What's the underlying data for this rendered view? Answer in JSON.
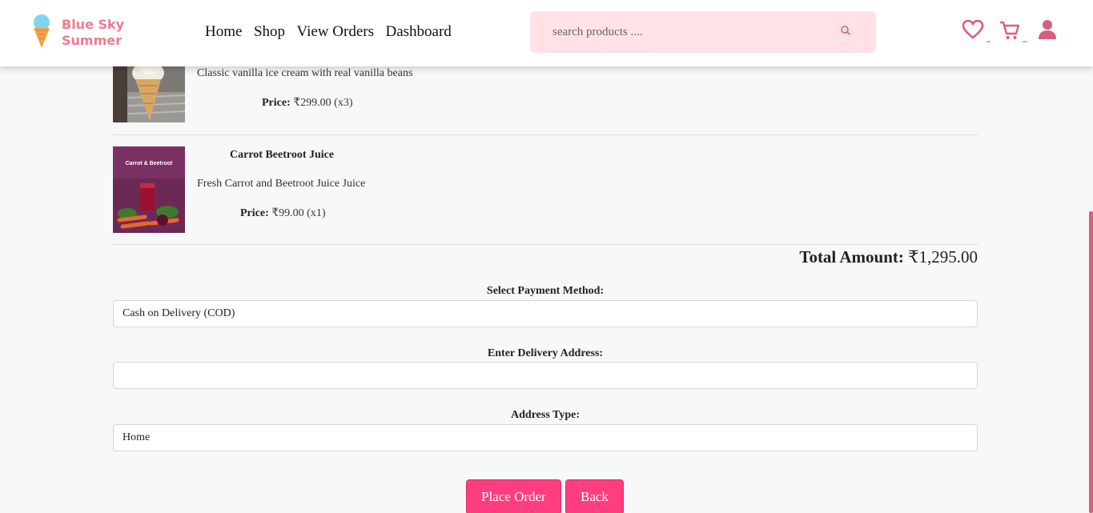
{
  "brand": {
    "line1": "Blue Sky",
    "line2": "Summer"
  },
  "nav": {
    "home": "Home",
    "shop": "Shop",
    "orders": "View Orders",
    "dashboard": "Dashboard"
  },
  "search": {
    "placeholder": "search products ....",
    "icon": "search-icon"
  },
  "header_icons": [
    "heart-icon",
    "cart-icon",
    "user-icon"
  ],
  "items": [
    {
      "name": "",
      "description": "Classic vanilla ice cream with real vanilla beans",
      "price_label": "Price:",
      "price": "₹299.00 (x3)"
    },
    {
      "name": "Carrot Beetroot Juice",
      "description": "Fresh Carrot and Beetroot Juice Juice",
      "price_label": "Price:",
      "price": "₹99.00 (x1)",
      "image_title": "Carrot & Beetroot"
    }
  ],
  "total": {
    "label": "Total Amount:",
    "value": "₹1,295.00"
  },
  "payment": {
    "label": "Select Payment Method:",
    "value": "Cash on Delivery (COD)"
  },
  "address": {
    "label": "Enter Delivery Address:",
    "value": ""
  },
  "address_type": {
    "label": "Address Type:",
    "value": "Home"
  },
  "buttons": {
    "place_order": "Place Order",
    "back": "Back"
  },
  "colors": {
    "brand": "#ef7b8e",
    "accent": "#ff3d7f",
    "icon": "#d6607e",
    "search_bg": "#ffe1e6"
  }
}
